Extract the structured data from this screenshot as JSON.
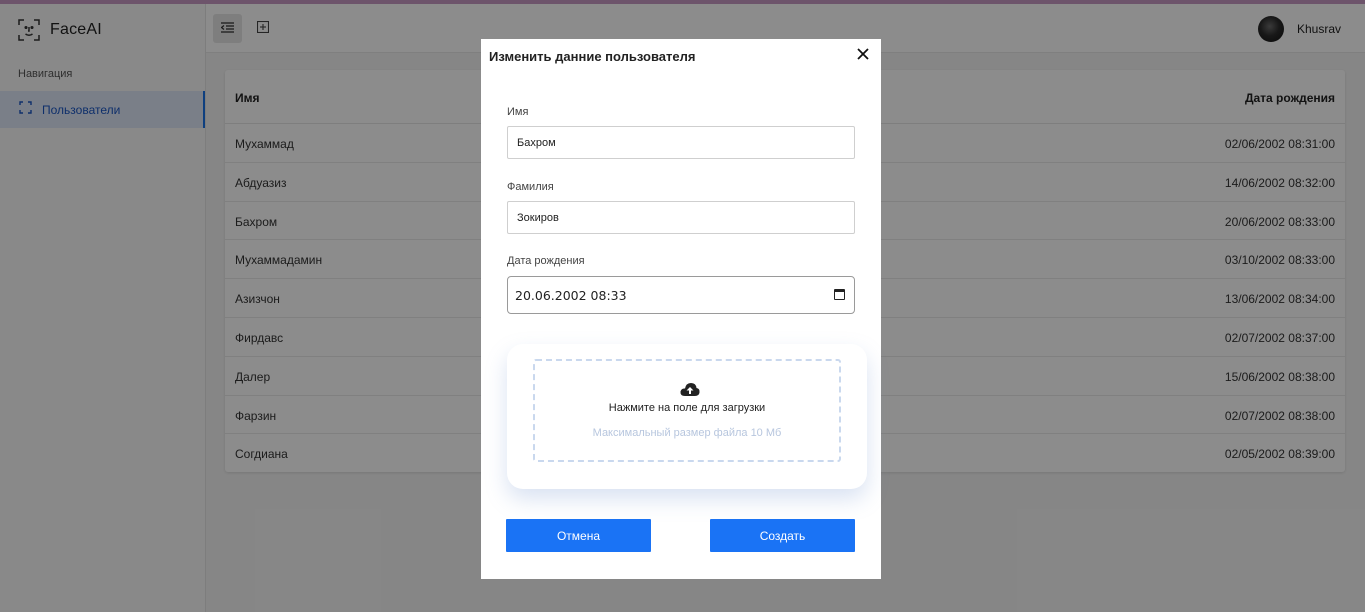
{
  "app": {
    "name": "FaceAI"
  },
  "sidebar": {
    "heading": "Навигация",
    "items": [
      {
        "label": "Пользователи",
        "icon": "scan-frame-icon",
        "active": true
      }
    ]
  },
  "header": {
    "buttons": [
      {
        "icon": "menu-collapse-icon",
        "active": true
      },
      {
        "icon": "add-square-icon",
        "active": false
      }
    ],
    "user": {
      "name": "Khusrav"
    }
  },
  "table": {
    "columns": [
      "Имя",
      "Дата рождения"
    ],
    "rows": [
      {
        "name": "Мухаммад",
        "birth": "02/06/2002 08:31:00"
      },
      {
        "name": "Абдуазиз",
        "birth": "14/06/2002 08:32:00"
      },
      {
        "name": "Бахром",
        "birth": "20/06/2002 08:33:00"
      },
      {
        "name": "Мухаммадамин",
        "birth": "03/10/2002 08:33:00"
      },
      {
        "name": "Азизчон",
        "birth": "13/06/2002 08:34:00"
      },
      {
        "name": "Фирдавс",
        "birth": "02/07/2002 08:37:00"
      },
      {
        "name": "Далер",
        "birth": "15/06/2002 08:38:00"
      },
      {
        "name": "Фарзин",
        "birth": "02/07/2002 08:38:00"
      },
      {
        "name": "Согдиана",
        "birth": "02/05/2002 08:39:00"
      }
    ]
  },
  "modal": {
    "title": "Изменить данние пользователя",
    "first_name": {
      "label": "Имя",
      "value": "Бахром"
    },
    "last_name": {
      "label": "Фамилия",
      "value": "Зокиров"
    },
    "birth_date": {
      "label": "Дата рождения",
      "value": "20.06.2002 08:33"
    },
    "upload": {
      "text": "Нажмите на поле для загрузки",
      "hint": "Максимальный размер файла 10 Мб"
    },
    "cancel_label": "Отмена",
    "submit_label": "Создать"
  },
  "colors": {
    "accent": "#1a73f5",
    "sidebar_active_bg": "#dfe8f7",
    "overlay": "rgba(0,0,0,0.45)"
  }
}
